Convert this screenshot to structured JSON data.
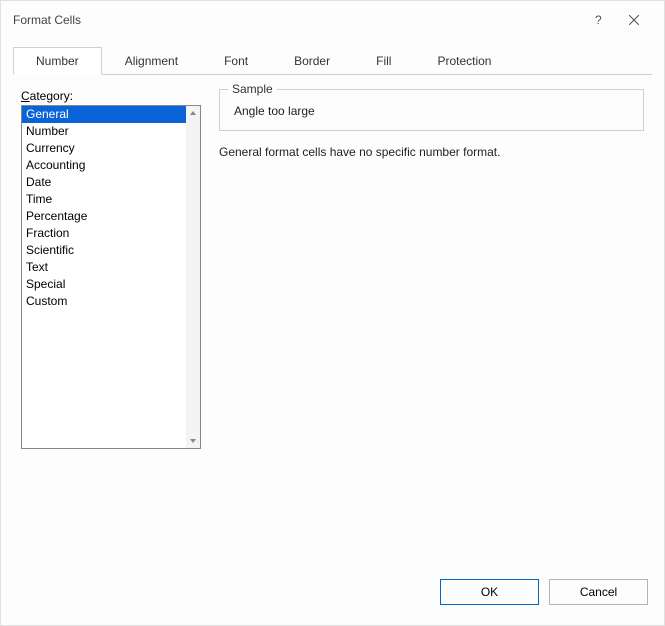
{
  "title": "Format Cells",
  "tabs": [
    {
      "label": "Number",
      "active": true
    },
    {
      "label": "Alignment",
      "active": false
    },
    {
      "label": "Font",
      "active": false
    },
    {
      "label": "Border",
      "active": false
    },
    {
      "label": "Fill",
      "active": false
    },
    {
      "label": "Protection",
      "active": false
    }
  ],
  "category_label": "Category:",
  "categories": [
    "General",
    "Number",
    "Currency",
    "Accounting",
    "Date",
    "Time",
    "Percentage",
    "Fraction",
    "Scientific",
    "Text",
    "Special",
    "Custom"
  ],
  "selected_category_index": 0,
  "sample": {
    "label": "Sample",
    "value": "Angle too large"
  },
  "description": "General format cells have no specific number format.",
  "footer": {
    "ok": "OK",
    "cancel": "Cancel"
  }
}
